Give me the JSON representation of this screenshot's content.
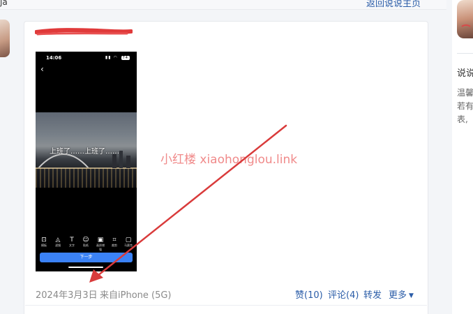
{
  "topbar": {
    "left_text": "ĵa",
    "back_link": "返回说说主页"
  },
  "post": {
    "watermark": "小红楼 xiaohonglou.link",
    "phone": {
      "time": "14:06",
      "battery": "74",
      "photo_caption": "上班了……上班了……",
      "tools": [
        {
          "glyph": "⊡",
          "label": "模板"
        },
        {
          "glyph": "◬",
          "label": "滤镜"
        },
        {
          "glyph": "T",
          "label": "文字"
        },
        {
          "glyph": "☺",
          "label": "贴纸"
        },
        {
          "glyph": "▣",
          "label": "画质增强"
        },
        {
          "glyph": "⌗",
          "label": "裁剪"
        },
        {
          "glyph": "▢",
          "label": "马赛克"
        }
      ],
      "next_button": "下一步"
    },
    "date": "2024年3月3日",
    "source": "来自iPhone (5G)",
    "actions": {
      "like": "赞(10)",
      "comment": "评论(4)",
      "repost": "转发",
      "more": "更多"
    }
  },
  "sidebar": {
    "title": "说说",
    "lines": [
      "温馨",
      "若有",
      "表,"
    ]
  },
  "colors": {
    "link": "#2b5da8",
    "annotation_arrow": "#d93b3b",
    "watermark": "#f08a8a",
    "next_button": "#3b82f6"
  }
}
